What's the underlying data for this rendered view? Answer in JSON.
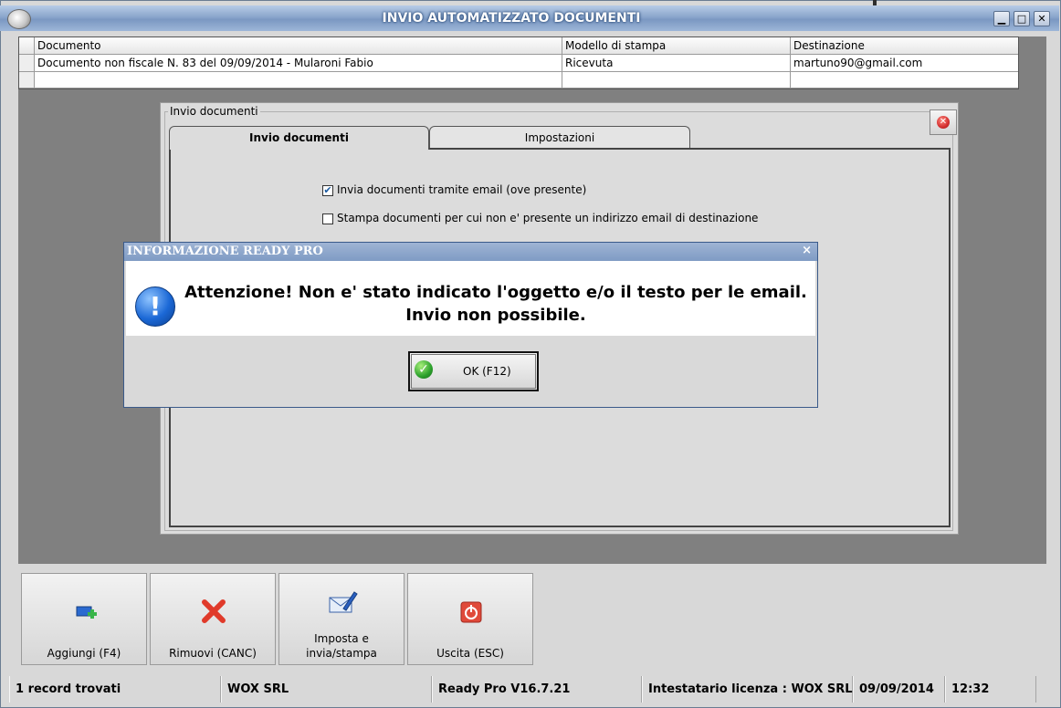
{
  "window": {
    "title": "INVIO AUTOMATIZZATO DOCUMENTI",
    "minimize_glyph": "▁",
    "maximize_glyph": "□",
    "close_glyph": "✕"
  },
  "grid": {
    "columns": [
      "Documento",
      "Modello di stampa",
      "Destinazione"
    ],
    "rows": [
      [
        "Documento non fiscale N. 83 del 09/09/2014 - Mularoni Fabio",
        "Ricevuta",
        "martuno90@gmail.com"
      ],
      [
        "",
        "",
        ""
      ]
    ]
  },
  "panel": {
    "group_title": "Invio documenti",
    "tabs": [
      "Invio documenti",
      "Impostazioni"
    ],
    "active_tab": "Invio documenti",
    "options": [
      {
        "label": "Invia documenti tramite email (ove presente)",
        "checked": true
      },
      {
        "label": "Stampa documenti per cui non e' presente un indirizzo email di destinazione",
        "checked": false
      }
    ]
  },
  "dialog": {
    "title": "INFORMAZIONE READY PRO",
    "close_glyph": "×",
    "icon": "info-exclamation-icon",
    "message_line1": "Attenzione! Non e' stato indicato l'oggetto e/o il testo per le email.",
    "message_line2": "Invio non possibile.",
    "ok_label": "OK (F12)"
  },
  "toolbar": {
    "add_label": "Aggiungi (F4)",
    "remove_label": "Rimuovi (CANC)",
    "setup_label_1": "Imposta e",
    "setup_label_2": "invia/stampa",
    "exit_label": "Uscita (ESC)"
  },
  "statusbar": {
    "records": "1 record trovati",
    "company": "WOX SRL",
    "version": "Ready Pro V16.7.21",
    "license": "Intestatario licenza : WOX SRL",
    "date": "09/09/2014",
    "time": "12:32"
  },
  "colors": {
    "title_gradient": "#8aa6cc",
    "info_icon": "#1b68d6",
    "ok_icon": "#2ca02c",
    "remove_icon": "#e03a2a"
  }
}
